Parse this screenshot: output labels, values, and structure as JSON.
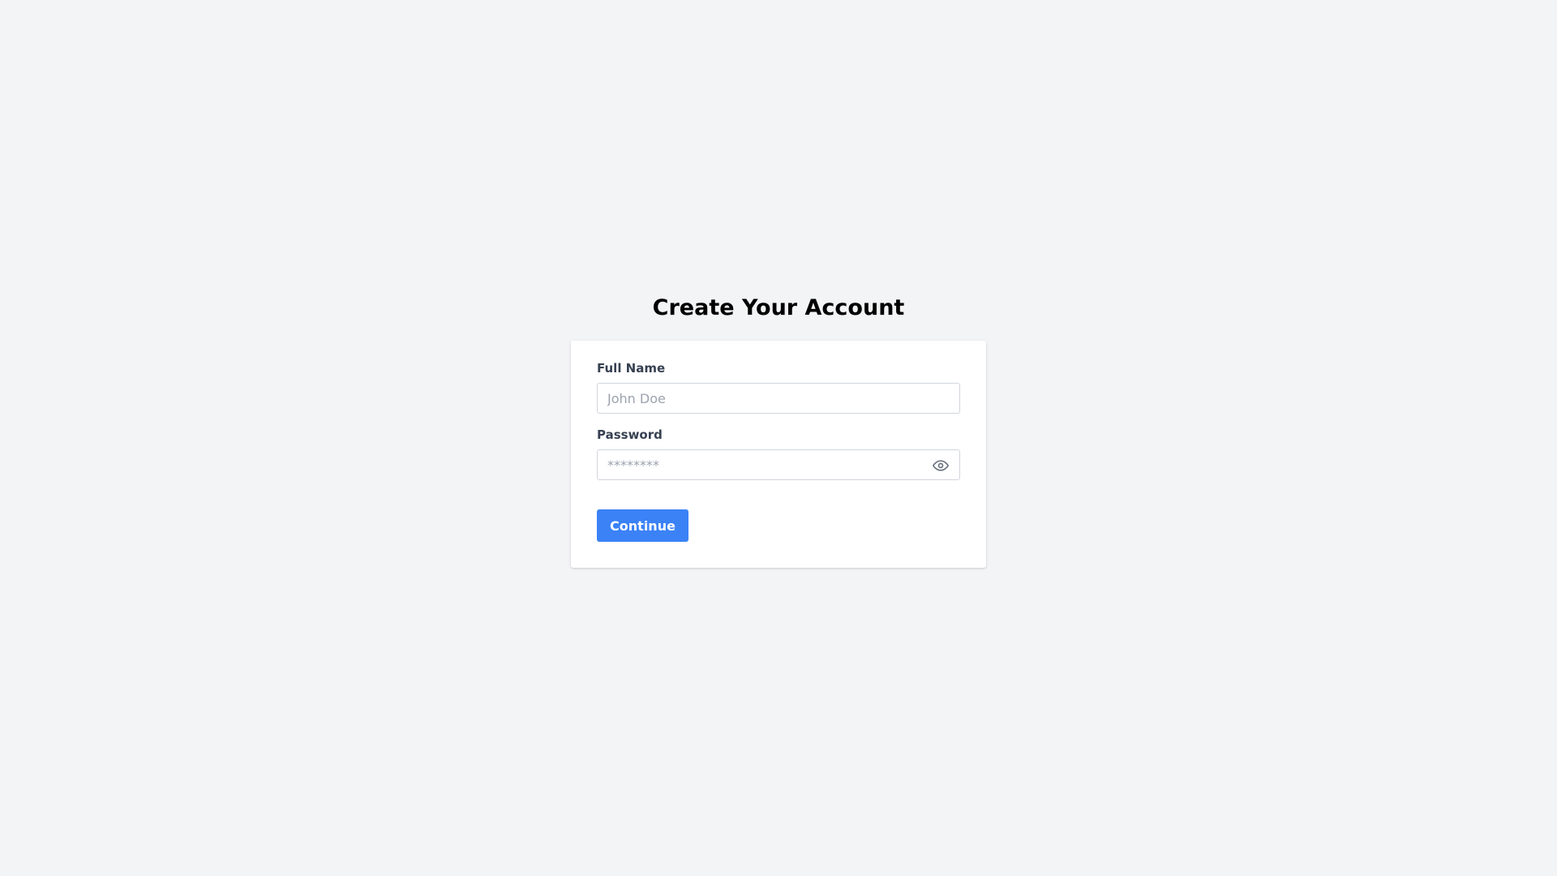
{
  "page": {
    "title": "Create Your Account"
  },
  "form": {
    "full_name": {
      "label": "Full Name",
      "value": "",
      "placeholder": "John Doe"
    },
    "password": {
      "label": "Password",
      "value": "",
      "placeholder": "********",
      "toggle_icon": "eye-icon"
    },
    "submit_label": "Continue"
  },
  "colors": {
    "background": "#f3f4f6",
    "card": "#ffffff",
    "accent": "#3b82f6",
    "label": "#374151",
    "placeholder": "#9ca3af"
  }
}
